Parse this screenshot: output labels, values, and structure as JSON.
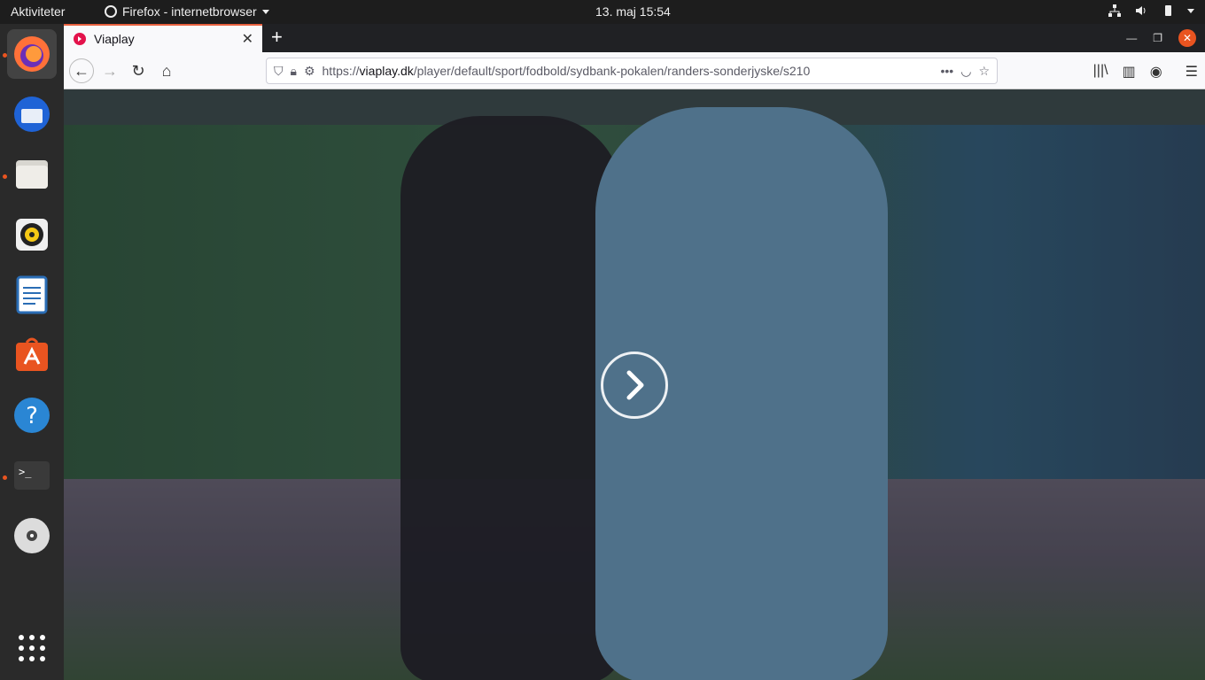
{
  "topbar": {
    "activities": "Aktiviteter",
    "app_name": "Firefox - internetbrowser",
    "clock": "13. maj  15:54"
  },
  "dock": {
    "items": [
      "firefox-icon",
      "thunderbird-icon",
      "files-icon",
      "rhythmbox-icon",
      "libreoffice-writer-icon",
      "ubuntu-software-icon",
      "help-icon",
      "terminal-icon",
      "dvd-icon",
      "show-apps-icon"
    ]
  },
  "browser": {
    "tab_title": "Viaplay",
    "url_prefix": "https://",
    "url_host": "viaplay.dk",
    "url_path": "/player/default/sport/fodbold/sydbank-pokalen/randers-sonderjyske/s210",
    "url_more": "•••"
  },
  "video": {
    "play_icon": "play-chevron-icon"
  }
}
